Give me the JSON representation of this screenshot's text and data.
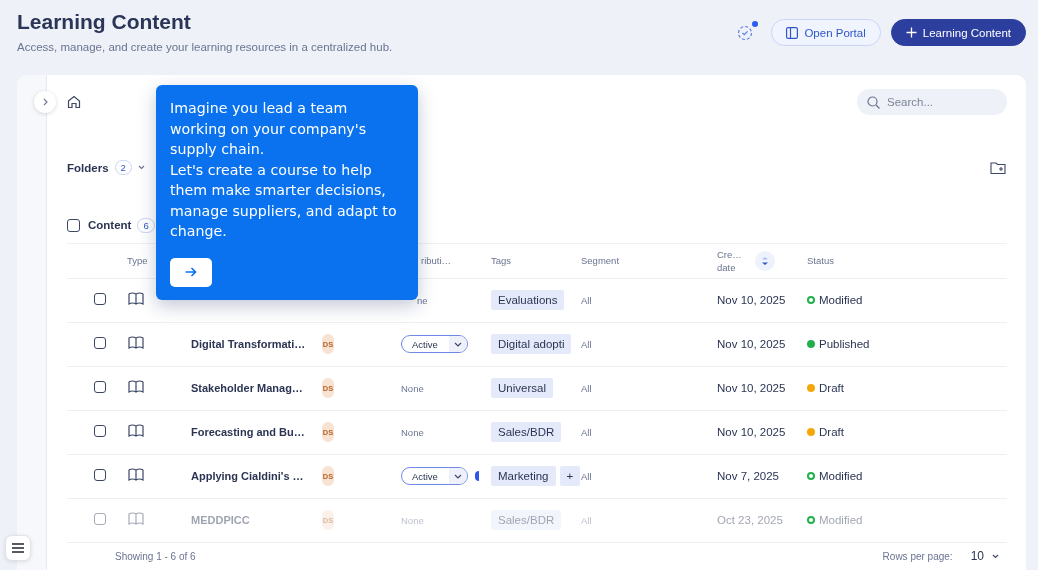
{
  "page": {
    "title": "Learning Content",
    "subtitle": "Access, manage, and create your learning resources in a centralized hub."
  },
  "header_actions": {
    "notification_dot": true,
    "buttons": [
      {
        "kind": "outline",
        "label": "Open Portal"
      },
      {
        "kind": "primary",
        "label": "Learning Content"
      }
    ]
  },
  "search": {
    "placeholder": "Search..."
  },
  "folders": {
    "label": "Folders",
    "count": "2"
  },
  "content": {
    "label": "Content",
    "count": "6",
    "checked": false
  },
  "table": {
    "columns": [
      {
        "label": "Type",
        "sorted": false
      },
      {
        "label": "ributi…",
        "sorted": false
      },
      {
        "label": "Tags",
        "sorted": false
      },
      {
        "label": "Segment",
        "sorted": false
      },
      {
        "label": "Cre… date",
        "sorted": true
      },
      {
        "label": "Status",
        "sorted": false
      }
    ],
    "rows": [
      {
        "checked": false,
        "disabled": false,
        "distribution": {
          "kind": "text",
          "label": "ne"
        },
        "tags": [
          "Evaluations"
        ],
        "segment": "All",
        "created": "Nov 10, 2025",
        "status": {
          "label": "Modified",
          "color": "#22b04b",
          "filled": false
        }
      },
      {
        "checked": false,
        "disabled": false,
        "title": "Digital Transformati…",
        "owner": "DS",
        "distribution": {
          "kind": "dropdown",
          "label": "Active"
        },
        "tags": [
          "Digital adopti"
        ],
        "segment": "All",
        "created": "Nov 10, 2025",
        "status": {
          "label": "Published",
          "color": "#22b04b",
          "filled": true
        }
      },
      {
        "checked": false,
        "disabled": false,
        "title": "Stakeholder Manag…",
        "owner": "DS",
        "distribution": {
          "kind": "text",
          "label": "None"
        },
        "tags": [
          "Universal"
        ],
        "segment": "All",
        "created": "Nov 10, 2025",
        "status": {
          "label": "Draft",
          "color": "#f5a70a",
          "filled": true
        }
      },
      {
        "checked": false,
        "disabled": false,
        "title": "Forecasting and Bu…",
        "owner": "DS",
        "distribution": {
          "kind": "text",
          "label": "None"
        },
        "tags": [
          "Sales/BDR"
        ],
        "segment": "All",
        "created": "Nov 10, 2025",
        "status": {
          "label": "Draft",
          "color": "#f5a70a",
          "filled": true
        }
      },
      {
        "checked": false,
        "disabled": false,
        "title": "Applying Cialdini's …",
        "owner": "DS",
        "distribution": {
          "kind": "dropdown",
          "label": "Active",
          "indicator": true
        },
        "tags": [
          "Marketing",
          "+"
        ],
        "segment": "All",
        "created": "Nov 7, 2025",
        "status": {
          "label": "Modified",
          "color": "#22b04b",
          "filled": false
        }
      },
      {
        "checked": false,
        "disabled": true,
        "title": "MEDDPICC",
        "owner": "DS",
        "distribution": {
          "kind": "text",
          "label": "None"
        },
        "tags": [
          "Sales/BDR"
        ],
        "segment": "All",
        "created": "Oct 23, 2025",
        "status": {
          "label": "Modified",
          "color": "#22b04b",
          "filled": false
        }
      }
    ]
  },
  "footer": {
    "showing": "Showing 1 - 6 of 6",
    "rows_per_page_label": "Rows per page:",
    "rows_per_page": "10"
  },
  "popover": {
    "text": "Imagine you lead a team working on your company's supply chain.\nLet's create a course to help them make smarter decisions, manage suppliers, and adapt to change."
  }
}
